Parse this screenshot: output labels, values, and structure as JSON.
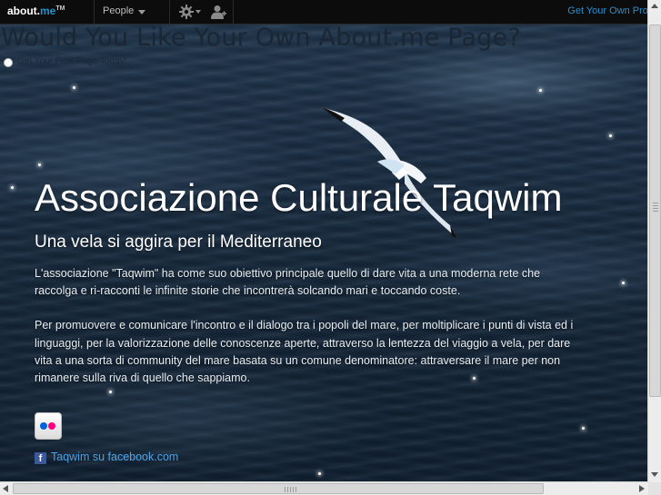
{
  "topbar": {
    "logo_text": "about.",
    "logo_accent": "me",
    "logo_tm": "TM",
    "people_label": "People",
    "get_own_profile": "Get Your Own Profile"
  },
  "banner": {
    "title": "Would You Like Your Own About.me Page?",
    "link": "Get Your Free Page Today!"
  },
  "profile": {
    "name": "Associazione Culturale Taqwim",
    "headline": "Una vela si aggira per il Mediterraneo",
    "bio_p1": "L'associazione \"Taqwim\" ha come suo obiettivo principale quello di dare vita a una moderna rete che raccolga e ri-racconti le infinite storie che incontrerà solcando mari e toccando coste.",
    "bio_p2": "Per promuovere e comunicare l'incontro e il dialogo tra i popoli del mare, per moltiplicare i punti di vista ed i linguaggi, per la valorizzazione delle conoscenze aperte, attraverso la lentezza del viaggio a vela, per dare vita a una sorta di community del mare basata su un comune denominatore: attraversare il mare per non rimanere sulla riva di quello che sappiamo.",
    "facebook_link": "Taqwim su facebook.com",
    "facebook_letter": "f"
  },
  "colors": {
    "accent": "#1f93d1",
    "link": "#4da3e6",
    "facebook": "#3b5998",
    "flickr_blue": "#0063dc",
    "flickr_pink": "#ff0084"
  },
  "icons": [
    "gear-icon",
    "add-person-icon",
    "flickr-icon",
    "facebook-icon",
    "seagull-image"
  ]
}
